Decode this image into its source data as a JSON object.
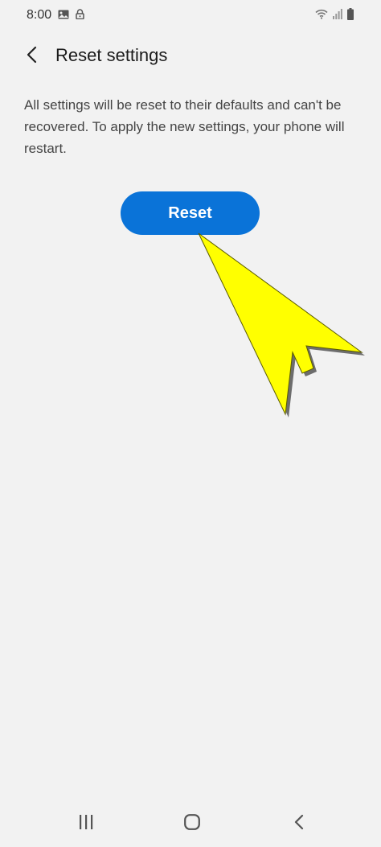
{
  "status_bar": {
    "time": "8:00",
    "left_icons": [
      "image-icon",
      "lock-icon"
    ],
    "right_icons": [
      "wifi-icon",
      "signal-icon",
      "battery-icon"
    ]
  },
  "header": {
    "back_icon": "chevron-left-icon",
    "title": "Reset settings"
  },
  "main": {
    "description": "All settings will be reset to their defaults and can't be recovered. To apply the new settings, your phone will restart.",
    "reset_label": "Reset"
  },
  "annotation": {
    "arrow_color": "#ffff00"
  },
  "nav_bar": {
    "buttons": [
      "recent-apps-icon",
      "home-icon",
      "back-icon"
    ]
  },
  "colors": {
    "background": "#f2f2f2",
    "accent": "#0a73d8"
  }
}
